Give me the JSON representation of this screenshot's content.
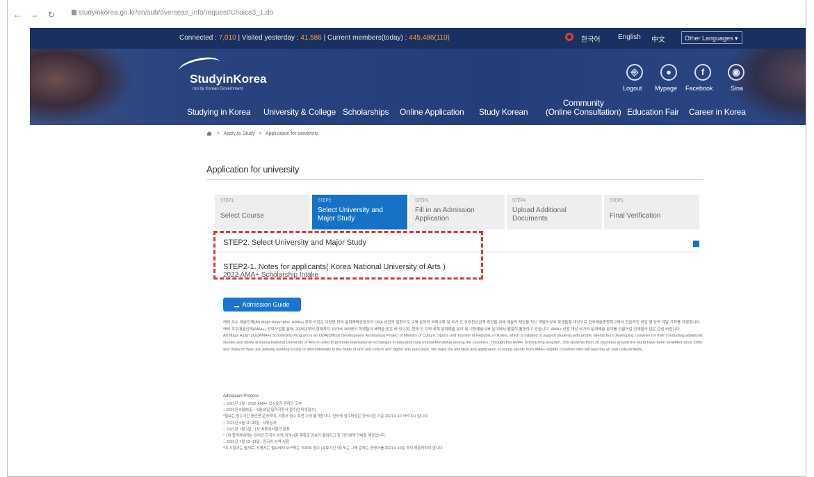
{
  "browser": {
    "url": "studyinkorea.go.kr/en/sub/overseas_info/request/Choice3_1.do"
  },
  "topstrip": {
    "connected_label": "Connected : ",
    "connected_value": "7,010",
    "visited_label": "| Visited yesterday : ",
    "visited_value": "41,586",
    "members_label": "| Current members(today) : ",
    "members_value": "445,486(110)",
    "lang_korean": "한국어",
    "lang_english": "English",
    "lang_chinese": "中文",
    "lang_other": "Other Languages ▾"
  },
  "header": {
    "logo_name": "StudyinKorea",
    "logo_sub": "run by Korean Government",
    "quick": [
      {
        "label": "Logout",
        "icon": "logout-icon",
        "glyph": "⎆"
      },
      {
        "label": "Mypage",
        "icon": "user-icon",
        "glyph": "●"
      },
      {
        "label": "Facebook",
        "icon": "facebook-icon",
        "glyph": "f"
      },
      {
        "label": "Sina",
        "icon": "weibo-icon",
        "glyph": "◉"
      }
    ],
    "nav": {
      "studying": "Studying in Korea",
      "university": "University & College",
      "scholarships": "Scholarships",
      "online": "Online Application",
      "study_korean": "Study Korean",
      "community_1": "Community",
      "community_2": "(Online Consultation)",
      "fair": "Education Fair",
      "career": "Career in Korea"
    }
  },
  "breadcrumb": {
    "sep1": ">",
    "apply": "Apply to Study",
    "sep2": ">",
    "current": "Application for university"
  },
  "page_title": "Application for university",
  "steps": [
    {
      "num": "STEP1.",
      "title": "Select Course"
    },
    {
      "num": "STEP2.",
      "title": "Select University and Major Study"
    },
    {
      "num": "STEP3.",
      "title": "Fill in an Admission Application"
    },
    {
      "num": "STEP4.",
      "title": "Upload Additional Documents"
    },
    {
      "num": "STEP5.",
      "title": "Final Verification"
    }
  ],
  "section": {
    "step2_title": "STEP2. Select University and Major Study",
    "notes_title": "STEP2-1. Notes for applicants( Korea National University of Arts )",
    "overlap_text": "2022 AMA+ Scholarship Intake",
    "admission_button": "Admission Guide"
  },
  "intro": {
    "ko": "해외 우수 예술인재(Art Major Asian plus, AMA+) 장학 사업은 다양한 한국 문화체육관광부의 ODA 사업의 일환으로 교육 분야의 국제교류 및 국가 간 상호친선관계 촉진을 위해 예술적 재능을 지닌 개발도상국 학생들을 대상으로 한국예술종합학교에서 전문적인 학업 및 능력 계발 기회를 지원합니다. 해외 우수예술인재(AMA+) 장학사업을 통해, 2005년부터 현재까지 30개국 309명의 학생들이 혜택을 받은 바 있으며, 현재 전 지역 세계 문화예술 분야 및 고등예술교육 분야에서 활발히 활동하고 있습니다. AMA+ 선발 대상 국가의 문화예술 분야를 이끌어갈 인재들의 많은 관심 바랍니다.",
    "en": "Art Major Asian plus(AMA+) Scholarship Program is an ODA(Official Development Assistance) Project of Ministry of Culture, Sports and Tourism of Republic or Korea, which is initiated to support students with artistic talents from developing countries for their conducting advanced studies and ability at Korea National University of Arts in order to promote international exchanges in education and mutual friendship among the countries. Through this AMA+ Scholarship program, 309 students from 30 countries around the world have been benefited since 2005 and many of them are actively working locally or internationally in the fields of arts and culture and higher arts education. We hope the attention and application of young talents from AMA+ eligible countries who will lead the art and cultural fields."
  },
  "process": {
    "title": "Admission Process",
    "lines": [
      "○ 2021년 3월 : 2022 AMA+ 입시요강 온라인 고부",
      "○ 2021년 5월25일 ~ 6월10일 입학지원서 접수(인터넷접수)",
      "  *필요는 접수기간 동안만 운영하며, 지원서 접수 후엔 수정 불가합니다. 인터넷 접수마감은 한국시간 기준 2021.6.10 저녁 6시 입니다.",
      "○ 2021년 6월 11~30일 : 서류심사",
      "○ 2021년 7월 1일 : 1차 서류심사결과 발표",
      "  * 1차 합격자에게는 온라인 한국어 능력 자격시험 계획과 정보가 올려지고 및 가인에게 안내될 예정입니다.",
      "○ 2021년 7월 12~14일 : 한국어 능력 시험",
      "  *이 시험과는 별개로, 지원자는 필요에서 요구하는 TOPIK 점수 (유효기간 내) 또는 그에 준하는 증명서를 2021.6.10일 까지 제출하여야 한니다."
    ]
  }
}
